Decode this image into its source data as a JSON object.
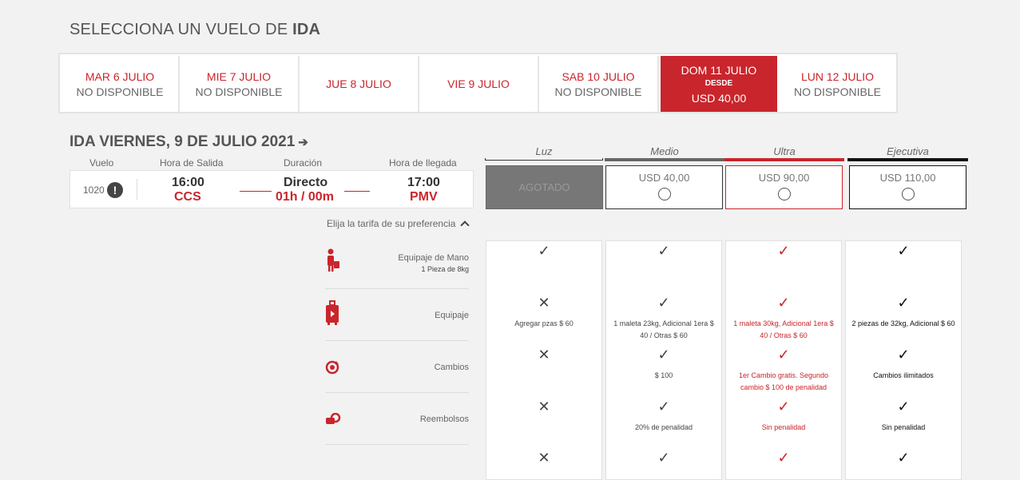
{
  "title": {
    "prefix": "SELECCIONA UN VUELO DE",
    "bold": "IDA"
  },
  "dates": [
    {
      "date": "MAR 6 JULIO",
      "status": "NO DISPONIBLE"
    },
    {
      "date": "MIE 7 JULIO",
      "status": "NO DISPONIBLE"
    },
    {
      "date": "JUE 8 JULIO",
      "status": ""
    },
    {
      "date": "VIE 9 JULIO",
      "status": ""
    },
    {
      "date": "SAB 10 JULIO",
      "status": "NO DISPONIBLE"
    },
    {
      "date": "DOM 11 JULIO",
      "from": "DESDE",
      "price": "USD 40,00"
    },
    {
      "date": "LUN 12 JULIO",
      "status": "NO DISPONIBLE"
    }
  ],
  "flight": {
    "heading": "IDA VIERNES, 9 DE JULIO 2021",
    "arrow": "➔",
    "headers": {
      "vuelo": "Vuelo",
      "salida": "Hora de Salida",
      "duracion": "Duración",
      "llegada": "Hora de llegada"
    },
    "number": "1020",
    "dep_time": "16:00",
    "dep_code": "CCS",
    "type": "Directo",
    "duration": "01h / 00m",
    "arr_time": "17:00",
    "arr_code": "PMV"
  },
  "tiers": [
    {
      "name": "Luz",
      "price": "AGOTADO"
    },
    {
      "name": "Medio",
      "price": "USD 40,00"
    },
    {
      "name": "Ultra",
      "price": "USD 90,00"
    },
    {
      "name": "Ejecutiva",
      "price": "USD 110,00"
    }
  ],
  "colors": {
    "accent": "#c9252c",
    "dark": "#111111",
    "gray": "#555555"
  },
  "preference": "Elija la tarifa de su preferencia",
  "features": [
    {
      "label": "Equipaje de Mano",
      "sub": "1 Pieza de 8kg",
      "icon": "person-luggage-icon"
    },
    {
      "label": "Equipaje",
      "sub": "",
      "icon": "suitcase-icon"
    },
    {
      "label": "Cambios",
      "sub": "",
      "icon": "change-icon"
    },
    {
      "label": "Reembolsos",
      "sub": "",
      "icon": "refund-icon"
    }
  ],
  "matrix": {
    "luz": {
      "equipaje": "Agregar pzas $ 60"
    },
    "medio": {
      "equipaje": "1 maleta 23kg, Adicional 1era $ 40 / Otras $ 60",
      "cambios": "$ 100",
      "reembolsos": "20% de penalidad"
    },
    "ultra": {
      "equipaje": "1 maleta 30kg, Adicional 1era $ 40 / Otras $ 60",
      "cambios": "1er Cambio gratis. Segundo cambio $ 100 de penalidad",
      "reembolsos": "Sin penalidad"
    },
    "ejecutiva": {
      "equipaje": "2 piezas de 32kg, Adicional $ 60",
      "cambios": "Cambios ilimitados",
      "reembolsos": "Sin penalidad"
    }
  }
}
